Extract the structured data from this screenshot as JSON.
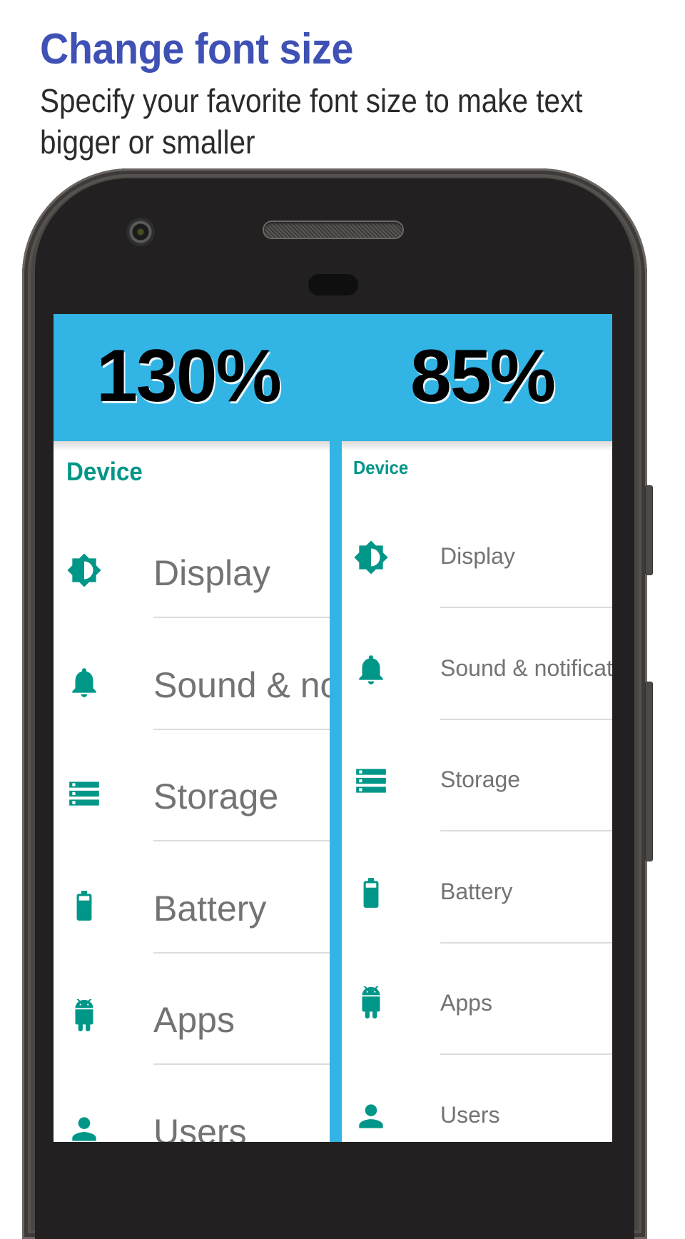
{
  "promo": {
    "title": "Change font size",
    "subtitle": "Specify your favorite font size to make text bigger or smaller"
  },
  "colors": {
    "title": "#3f51b5",
    "header_bg": "#32b4e4",
    "accent": "#009688",
    "label": "#737373"
  },
  "comparison": {
    "left": {
      "scale_label": "130%",
      "section_header": "Device",
      "items": [
        {
          "icon": "brightness-icon",
          "label": "Display"
        },
        {
          "icon": "bell-icon",
          "label": "Sound & notification"
        },
        {
          "icon": "storage-icon",
          "label": "Storage"
        },
        {
          "icon": "battery-icon",
          "label": "Battery"
        },
        {
          "icon": "android-icon",
          "label": "Apps"
        },
        {
          "icon": "person-icon",
          "label": "Users"
        }
      ]
    },
    "right": {
      "scale_label": "85%",
      "section_header": "Device",
      "items": [
        {
          "icon": "brightness-icon",
          "label": "Display"
        },
        {
          "icon": "bell-icon",
          "label": "Sound & notification"
        },
        {
          "icon": "storage-icon",
          "label": "Storage"
        },
        {
          "icon": "battery-icon",
          "label": "Battery"
        },
        {
          "icon": "android-icon",
          "label": "Apps"
        },
        {
          "icon": "person-icon",
          "label": "Users"
        }
      ]
    }
  }
}
